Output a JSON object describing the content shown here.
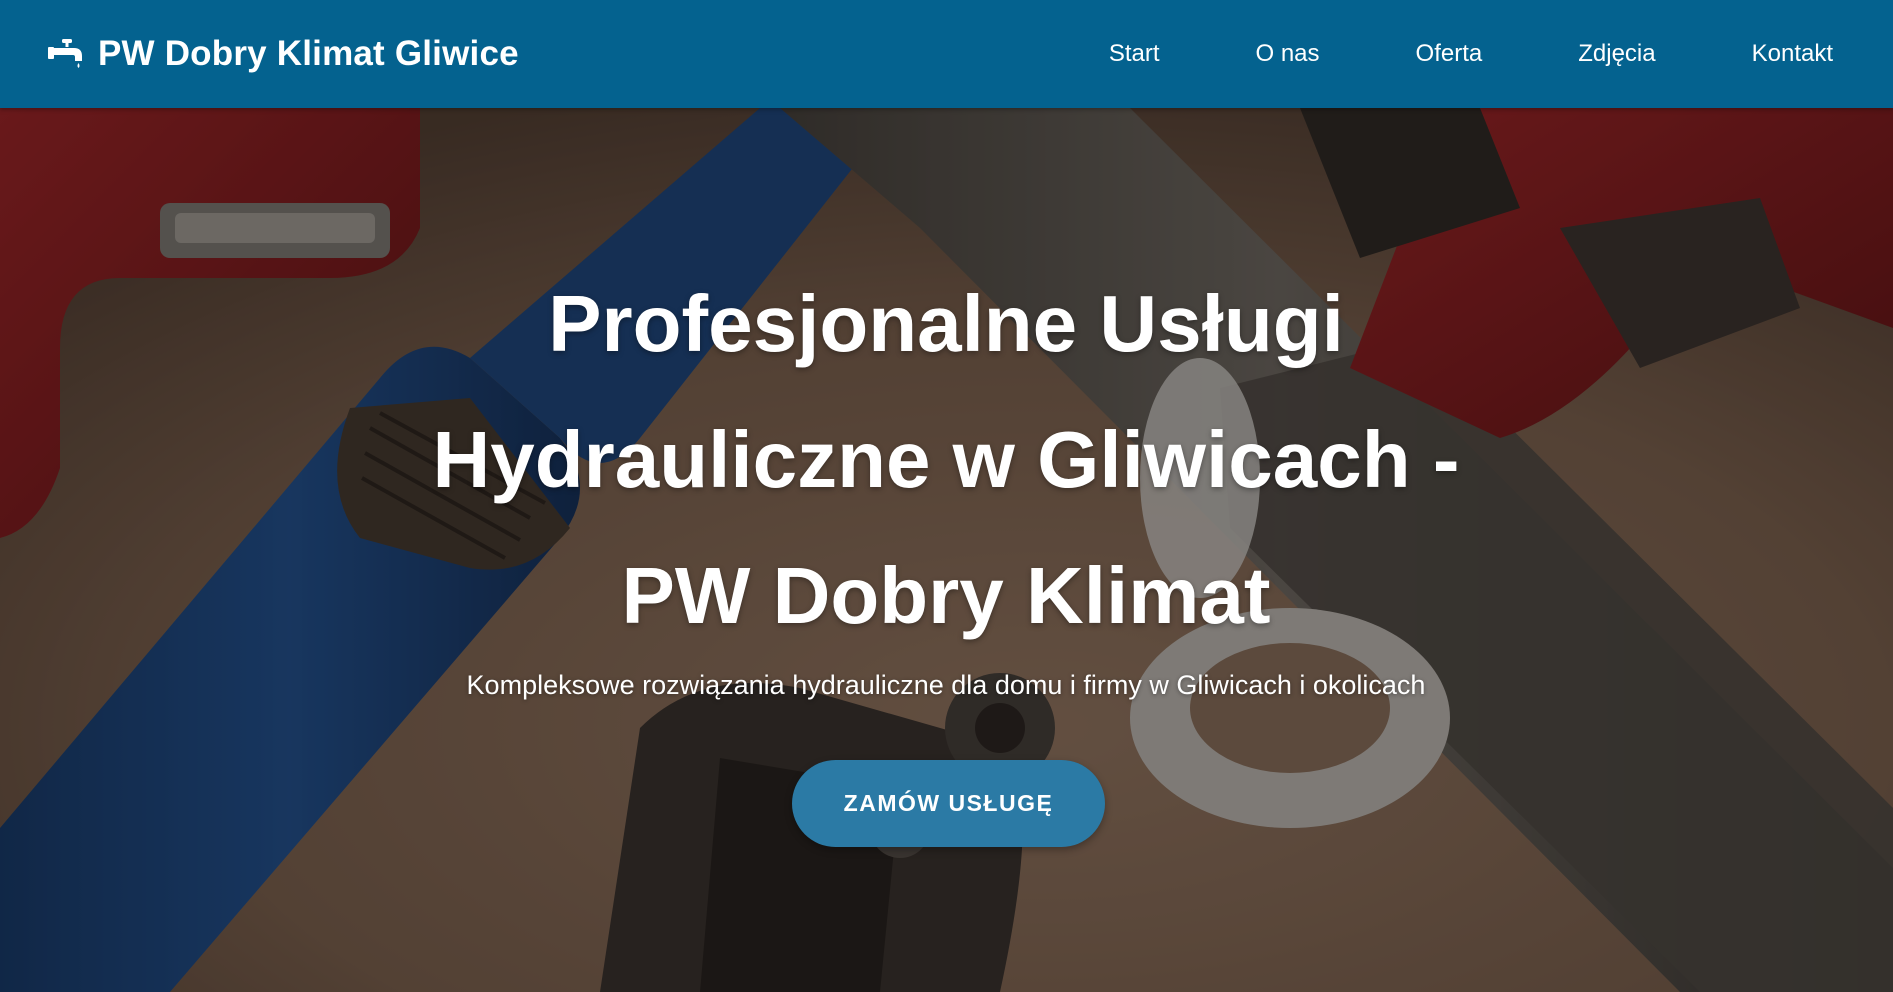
{
  "colors": {
    "navbar_bg": "#04628f",
    "button_bg": "#2b7aa5",
    "text": "#ffffff"
  },
  "header": {
    "brand_icon": "faucet-icon",
    "brand_name": "PW Dobry Klimat Gliwice",
    "nav": [
      {
        "label": "Start"
      },
      {
        "label": "O nas"
      },
      {
        "label": "Oferta"
      },
      {
        "label": "Zdjęcia"
      },
      {
        "label": "Kontakt"
      }
    ]
  },
  "hero": {
    "background_image": "plumbing-wrenches-photo",
    "title": "Profesjonalne Usługi Hydrauliczne w Gliwicach - PW Dobry Klimat",
    "subtitle": "Kompleksowe rozwiązania hydrauliczne dla domu i firmy w Gliwicach i okolicach",
    "cta_label": "ZAMÓW USŁUGĘ"
  }
}
